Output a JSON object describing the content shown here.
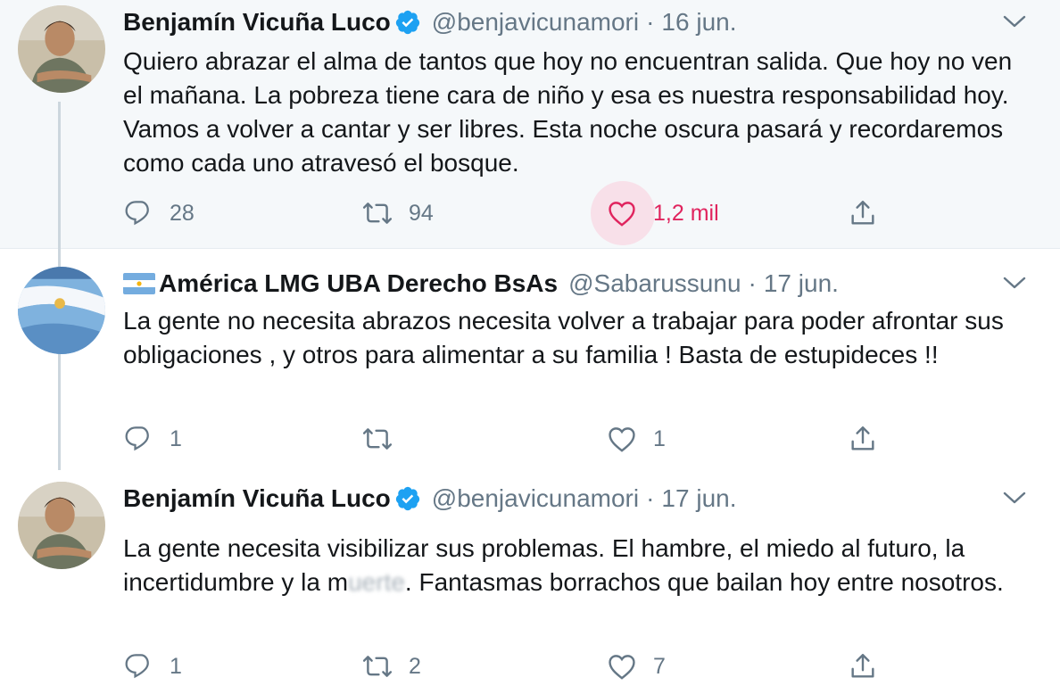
{
  "tweets": [
    {
      "name": "Benjamín Vicuña Luco",
      "handle": "@benjavicunamori",
      "sep": "·",
      "date": "16 jun.",
      "text": "Quiero abrazar el alma de tantos que hoy no encuentran salida. Que hoy no ven el mañana. La pobreza tiene cara de niño y esa es nuestra responsabilidad hoy. Vamos a volver a cantar y ser libres. Esta noche oscura pasará y recordaremos como cada uno atravesó el bosque.",
      "replies": "28",
      "retweets": "94",
      "likes": "1,2 mil",
      "liked": true
    },
    {
      "name": "América LMG UBA Derecho BsAs",
      "handle": "@Sabarussunu",
      "sep": "·",
      "date": "17 jun.",
      "text": "La gente no necesita abrazos necesita volver a trabajar para poder afrontar sus obligaciones , y otros para alimentar a su familia ! Basta de estupideces !!",
      "replies": "1",
      "retweets": "",
      "likes": "1",
      "liked": false
    },
    {
      "name": "Benjamín Vicuña Luco",
      "handle": "@benjavicunamori",
      "sep": "·",
      "date": "17 jun.",
      "text_before": "La gente necesita visibilizar sus problemas. El hambre, el miedo al futuro, la incertidumbre y la m",
      "text_blurred": "uerte",
      "text_after": ". Fantasmas borrachos que bailan hoy entre nosotros.",
      "replies": "1",
      "retweets": "2",
      "likes": "7",
      "liked": false
    }
  ],
  "colors": {
    "verified": "#1da1f2",
    "like_active": "#e0245e",
    "muted": "#657786",
    "highlight_bg": "#f5f8fa"
  },
  "icons": [
    "reply-icon",
    "retweet-icon",
    "like-icon",
    "share-icon",
    "verified-badge-icon",
    "chevron-down-icon",
    "argentina-flag-icon"
  ]
}
